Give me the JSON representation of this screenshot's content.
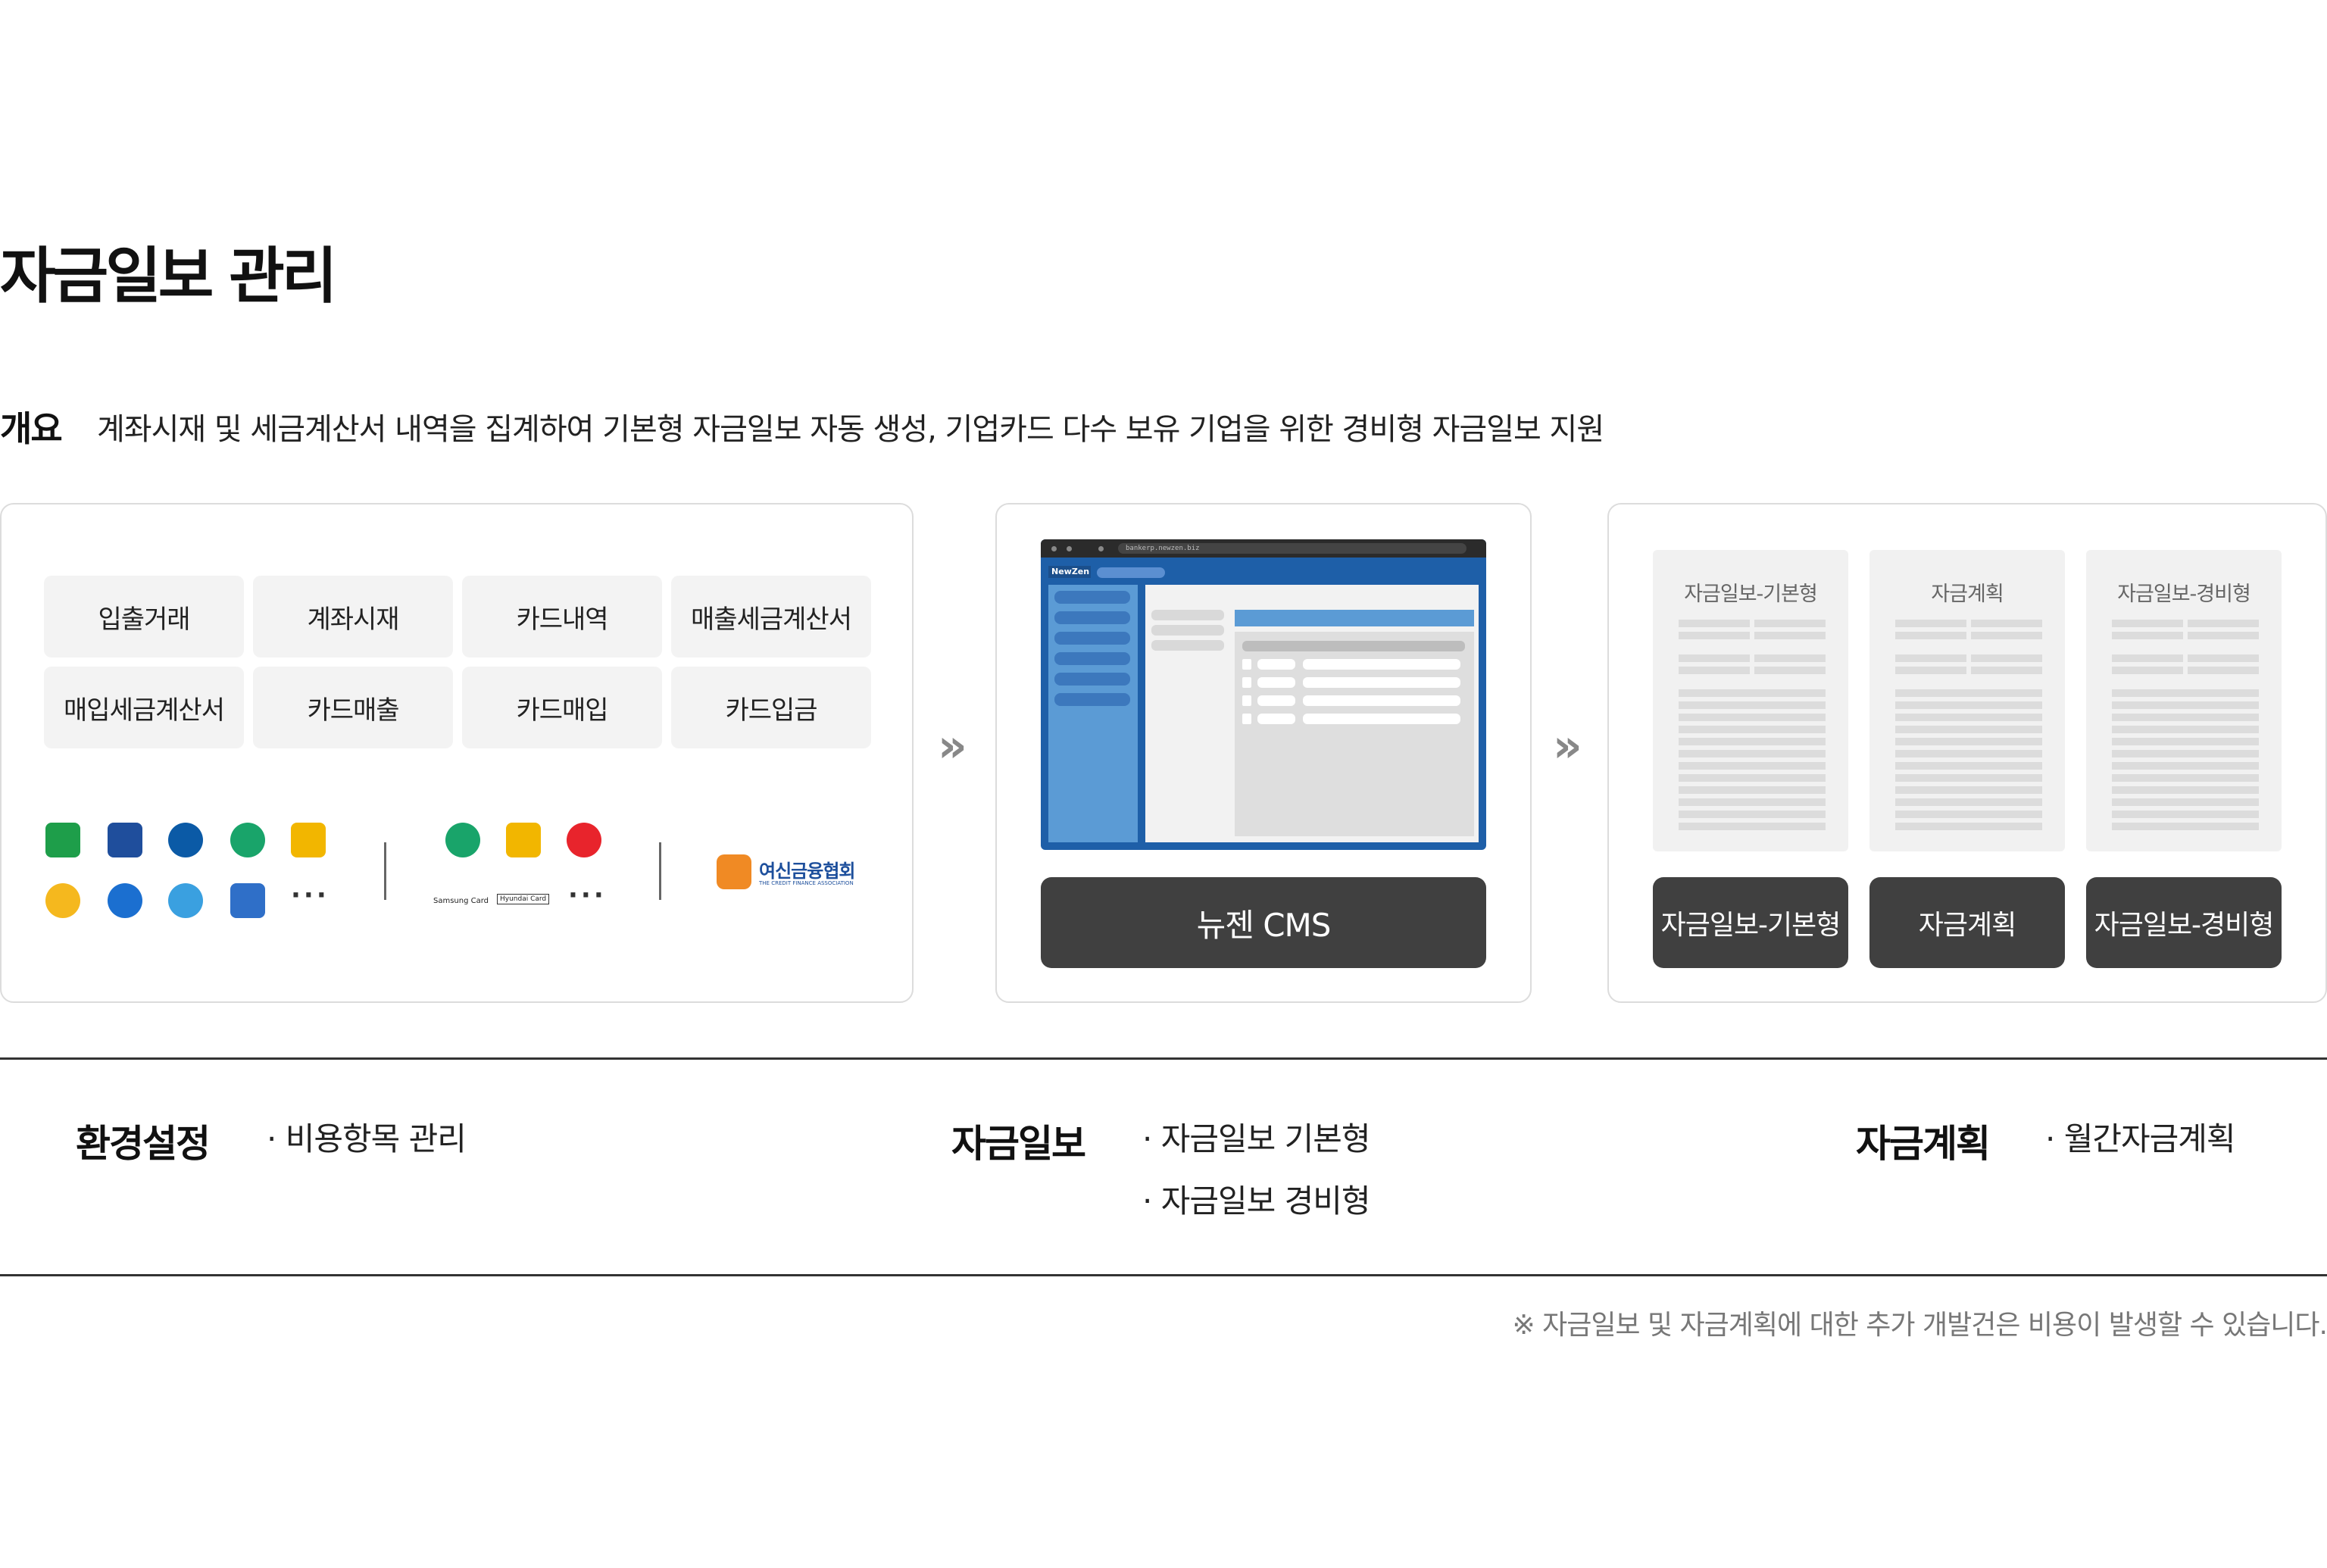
{
  "page_title": "자금일보 관리",
  "overview": {
    "label": "개요",
    "text": "계좌시재 및 세금계산서 내역을 집계하여 기본형 자금일보 자동 생성, 기업카드 다수 보유 기업을 위한 경비형 자금일보 지원"
  },
  "sources": {
    "chips": [
      "입출거래",
      "계좌시재",
      "카드내역",
      "매출세금계산서",
      "매입세금계산서",
      "카드매출",
      "카드매입",
      "카드입금"
    ],
    "bank_more": "···",
    "card_brands": [
      "Samsung Card",
      "Hyundai Card"
    ],
    "card_more": "···",
    "association": {
      "name": "여신금융협회",
      "subtitle": "THE CREDIT FINANCE ASSOCIATION"
    }
  },
  "arrow": "»",
  "cms": {
    "button_label": "뉴젠 CMS",
    "browser_url": "bankerp.newzen.biz",
    "browser_logo": "NewZen"
  },
  "outputs": {
    "documents": [
      "자금일보-기본형",
      "자금계획",
      "자금일보-경비형"
    ],
    "buttons": [
      "자금일보-기본형",
      "자금계획",
      "자금일보-경비형"
    ]
  },
  "features": {
    "settings": {
      "title": "환경설정",
      "items": [
        "· 비용항목 관리"
      ]
    },
    "daily": {
      "title": "자금일보",
      "items": [
        "· 자금일보 기본형",
        "· 자금일보 경비형"
      ]
    },
    "plan": {
      "title": "자금계획",
      "items": [
        "· 월간자금계획"
      ]
    }
  },
  "footnote": "※ 자금일보 및 자금계획에 대한 추가 개발건은 비용이 발생할 수 있습니다.",
  "colors": {
    "dark_button": "#404040",
    "chip_bg": "#f3f3f3",
    "cms_blue": "#1e5fa8"
  }
}
